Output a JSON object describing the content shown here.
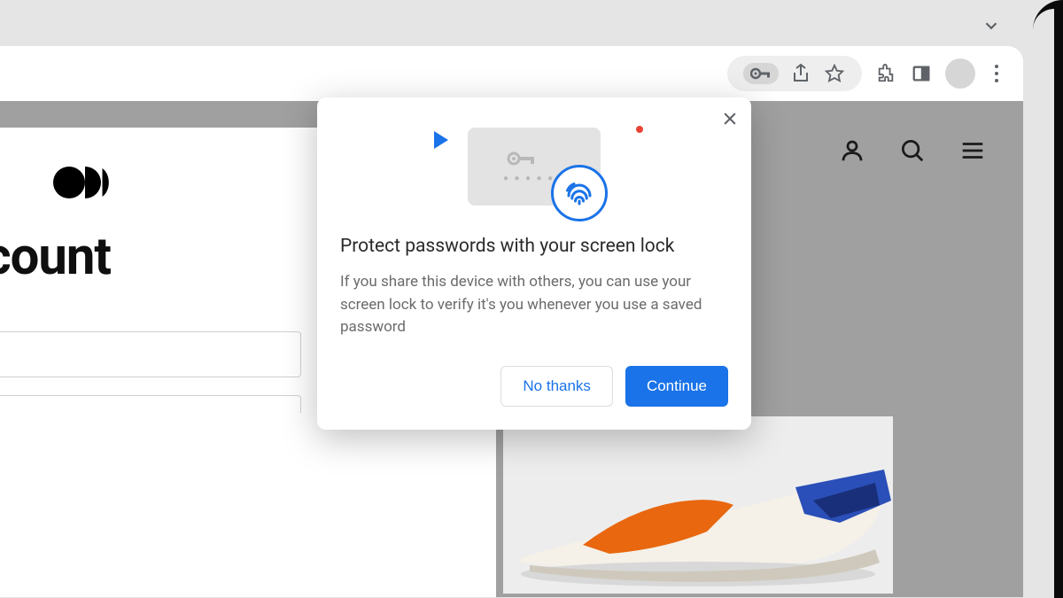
{
  "toolbar": {
    "icons": {
      "key": "key-icon",
      "share": "share-icon",
      "star": "star-icon",
      "extensions": "extensions-icon",
      "sidepanel": "sidepanel-icon",
      "profile": "profile-avatar",
      "menu": "menu-icon"
    }
  },
  "page": {
    "heading": "ur account",
    "header_icons": [
      "account-icon",
      "search-icon",
      "menu-icon"
    ]
  },
  "popup": {
    "title": "Protect passwords with your screen lock",
    "body": "If you share this device with others, you can use your screen lock to verify it's you whenever you use a saved password",
    "secondary_label": "No thanks",
    "primary_label": "Continue"
  },
  "colors": {
    "accent": "#1a73e8",
    "text_secondary": "#6b6b6b"
  }
}
